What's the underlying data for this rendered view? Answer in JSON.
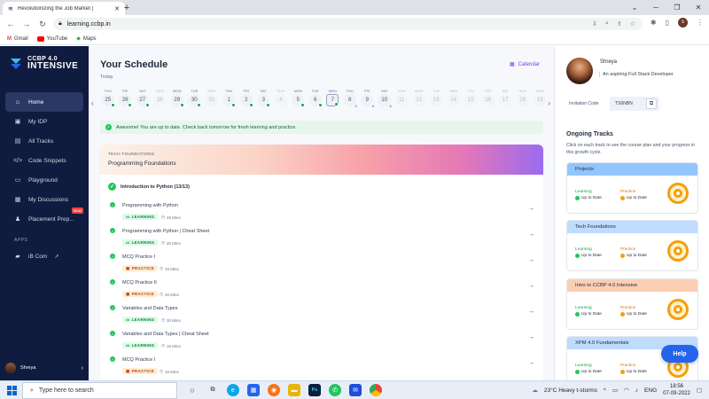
{
  "browser": {
    "tab_title": "Revolutionizing the Job Market |",
    "url": "learning.ccbp.in",
    "bookmarks": [
      "Gmail",
      "YouTube",
      "Maps"
    ],
    "profile_initial": "s"
  },
  "sidebar": {
    "logo_line1": "CCBP 4.0",
    "logo_line2": "INTENSIVE",
    "items": [
      {
        "label": "Home"
      },
      {
        "label": "My IDP"
      },
      {
        "label": "All Tracks"
      },
      {
        "label": "Code Snippets"
      },
      {
        "label": "Playground"
      },
      {
        "label": "My Discussions"
      },
      {
        "label": "Placement Prep...",
        "badge": "New"
      }
    ],
    "apps_label": "APPS",
    "apps": [
      {
        "label": "iB Com"
      }
    ],
    "user_name": "Shreya"
  },
  "schedule": {
    "title": "Your Schedule",
    "calendar_label": "Calendar",
    "today_label": "Today",
    "days": [
      {
        "name": "THU",
        "date": "25",
        "done": true
      },
      {
        "name": "FRI",
        "date": "26",
        "done": true
      },
      {
        "name": "SAT",
        "date": "27",
        "done": true
      },
      {
        "name": "SUN",
        "date": "28",
        "dim": true
      },
      {
        "name": "MON",
        "date": "29",
        "done": true
      },
      {
        "name": "TUE",
        "date": "30",
        "done": true
      },
      {
        "name": "WED",
        "date": "31",
        "dim": true
      },
      {
        "name": "THU",
        "date": "1",
        "done": true
      },
      {
        "name": "FRI",
        "date": "2",
        "done": true
      },
      {
        "name": "SAT",
        "date": "3",
        "done": true
      },
      {
        "name": "SUN",
        "date": "4",
        "dim": true
      },
      {
        "name": "MON",
        "date": "5",
        "done": true
      },
      {
        "name": "TUE",
        "date": "6",
        "done": true
      },
      {
        "name": "WED",
        "date": "7",
        "done": true,
        "selected": true
      },
      {
        "name": "THU",
        "date": "8",
        "count": "9"
      },
      {
        "name": "FRI",
        "date": "9",
        "count": "8"
      },
      {
        "name": "SAT",
        "date": "10",
        "count": "6"
      },
      {
        "name": "SUN",
        "date": "11",
        "dim": true
      },
      {
        "name": "MON",
        "date": "12",
        "dim": true
      },
      {
        "name": "TUE",
        "date": "13",
        "dim": true
      },
      {
        "name": "WED",
        "date": "14",
        "dim": true
      },
      {
        "name": "THU",
        "date": "15",
        "dim": true
      },
      {
        "name": "FRI",
        "date": "16",
        "dim": true
      },
      {
        "name": "SAT",
        "date": "17",
        "dim": true
      },
      {
        "name": "SUN",
        "date": "18",
        "dim": true
      },
      {
        "name": "MON",
        "date": "19",
        "dim": true
      }
    ],
    "banner": "Awesome! You are up to date. Check back tomorrow for fresh learning and practice.",
    "track_tag": "TECH FOUNDATIONS",
    "track_name": "Programming Foundations",
    "course_title": "Introduction to Python (13/13)",
    "items": [
      {
        "title": "Programming with Python",
        "type": "LEARNING",
        "duration": "45 Mins"
      },
      {
        "title": "Programming with Python | Cheat Sheet",
        "type": "LEARNING",
        "duration": "20 Mins"
      },
      {
        "title": "MCQ Practice I",
        "type": "PRACTICE",
        "duration": "15 Mins"
      },
      {
        "title": "MCQ Practice II",
        "type": "PRACTICE",
        "duration": "20 Mins"
      },
      {
        "title": "Variables and Data Types",
        "type": "LEARNING",
        "duration": "30 Mins"
      },
      {
        "title": "Variables and Data Types | Cheat Sheet",
        "type": "LEARNING",
        "duration": "15 Mins"
      },
      {
        "title": "MCQ Practice I",
        "type": "PRACTICE",
        "duration": "10 Mins"
      }
    ]
  },
  "profile": {
    "name": "Shreya",
    "tagline": "An aspiring Full Stack Developer",
    "invitation_label": "Invitation Code",
    "invitation_code": "TS6NBN"
  },
  "ongoing": {
    "title": "Ongoing Tracks",
    "subtitle": "Click on each track to see the course plan and your progress in this growth cycle.",
    "learning_label": "Learning",
    "practice_label": "Practice",
    "status": "Up to Date",
    "tracks": [
      {
        "name": "Projects",
        "color": "#93c5fd"
      },
      {
        "name": "Tech Foundations",
        "color": "#bfdbfe"
      },
      {
        "name": "Intro to CCBP 4.0 Intensive",
        "color": "#fbcfb1"
      },
      {
        "name": "XPM 4.0 Fundamentals",
        "color": "#bfdbfe"
      }
    ]
  },
  "help_label": "Help",
  "taskbar": {
    "search_placeholder": "Type here to search",
    "weather": "23°C  Heavy t-storms",
    "lang": "ENG",
    "time": "18:56",
    "date": "07-09-2022"
  }
}
